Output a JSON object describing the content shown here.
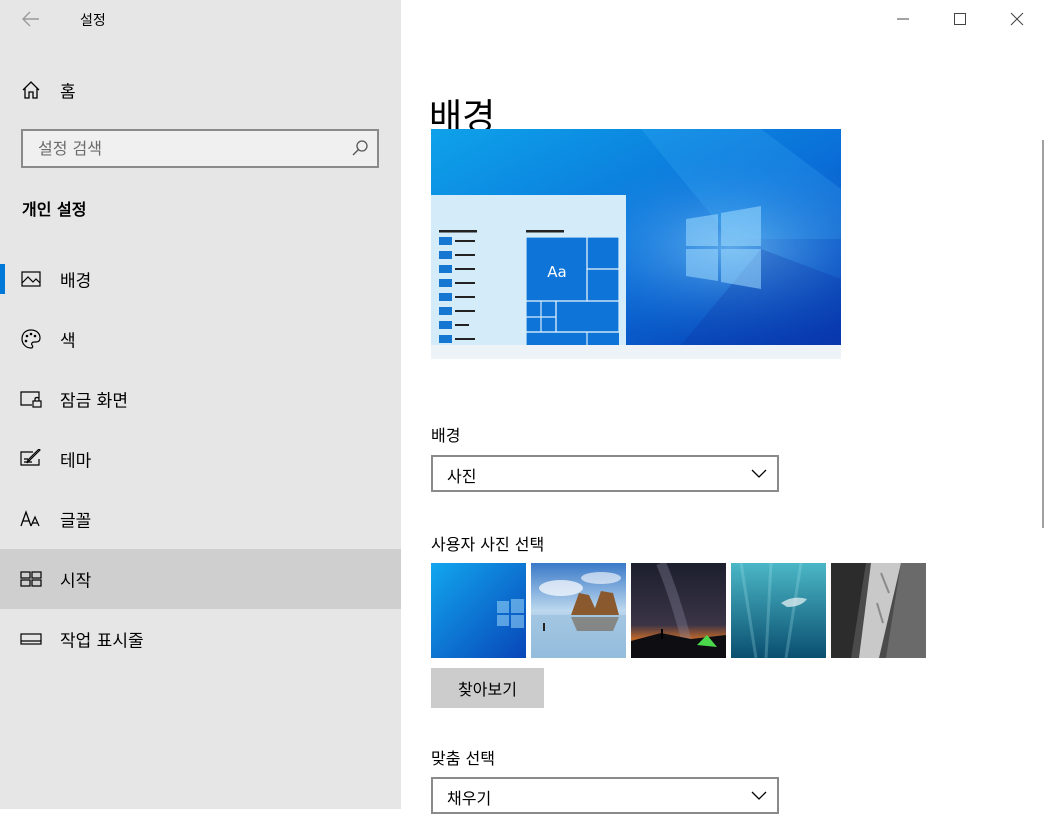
{
  "window": {
    "title": "설정",
    "controls": [
      "minimize-icon",
      "maximize-icon",
      "close-icon"
    ]
  },
  "sidebar": {
    "home_label": "홈",
    "search_placeholder": "설정 검색",
    "section_title": "개인 설정",
    "items": [
      {
        "label": "배경",
        "icon": "picture-icon",
        "state": "selected"
      },
      {
        "label": "색",
        "icon": "palette-icon",
        "state": "normal"
      },
      {
        "label": "잠금 화면",
        "icon": "lock-screen-icon",
        "state": "normal"
      },
      {
        "label": "테마",
        "icon": "theme-brush-icon",
        "state": "normal"
      },
      {
        "label": "글꼴",
        "icon": "font-icon",
        "state": "normal"
      },
      {
        "label": "시작",
        "icon": "start-icon",
        "state": "hover"
      },
      {
        "label": "작업 표시줄",
        "icon": "taskbar-icon",
        "state": "normal"
      }
    ]
  },
  "main": {
    "title": "배경",
    "preview": {
      "sample_text": "Aa"
    },
    "background_label": "배경",
    "background_value": "사진",
    "choose_picture_label": "사용자 사진 선택",
    "thumbnails": [
      "windows-blue",
      "beach-rocks",
      "night-sky-tent",
      "underwater-swimmer",
      "rock-cliff"
    ],
    "browse_label": "찾아보기",
    "fit_label": "맞춤 선택",
    "fit_value": "채우기"
  },
  "colors": {
    "accent": "#0078d7",
    "sidebar_bg": "#e6e6e6",
    "hover_bg": "#cfcfcf"
  }
}
